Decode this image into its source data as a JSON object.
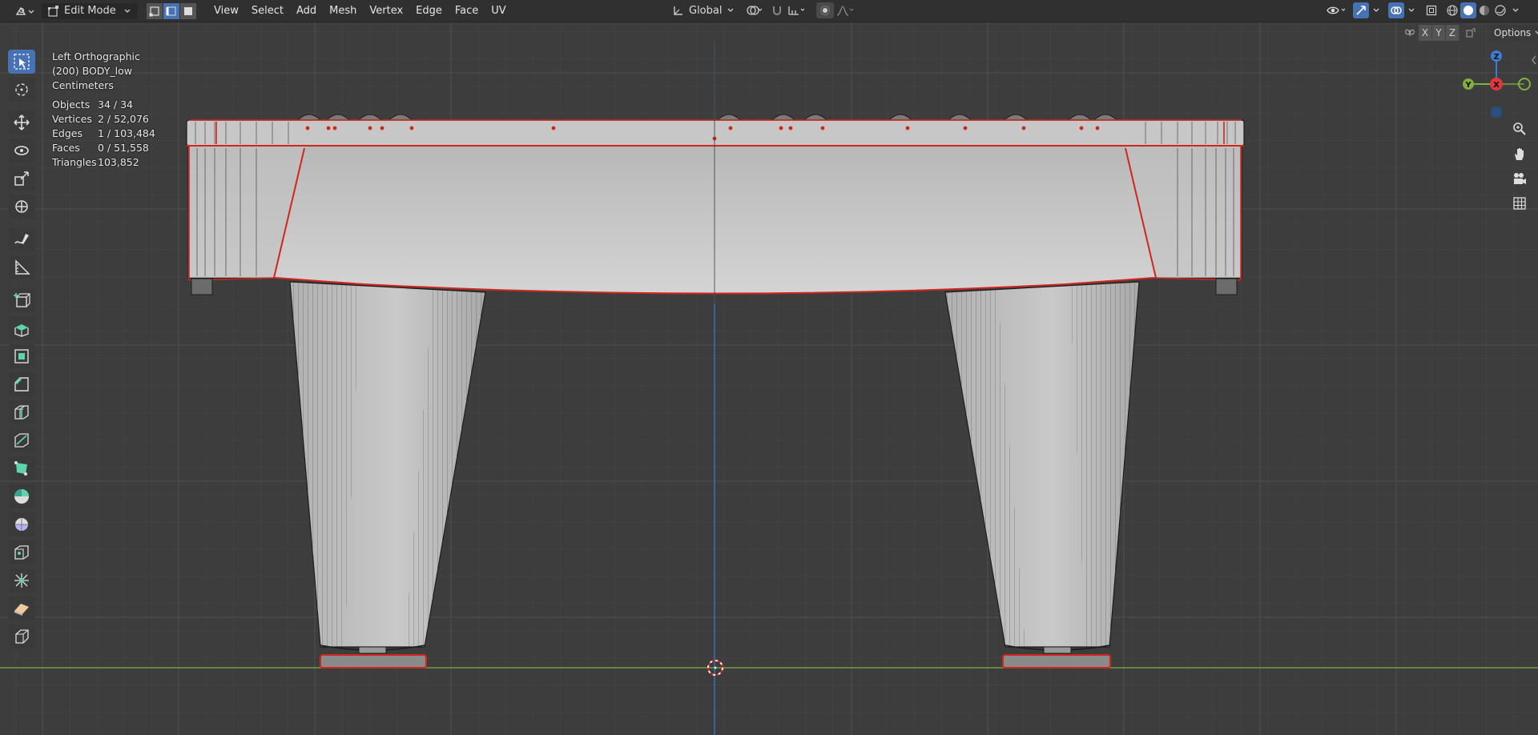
{
  "header": {
    "mode_label": "Edit Mode",
    "menus": [
      "View",
      "Select",
      "Add",
      "Mesh",
      "Vertex",
      "Edge",
      "Face",
      "UV"
    ],
    "transform_orientation": "Global"
  },
  "row2": {
    "axis_x": "X",
    "axis_y": "Y",
    "axis_z": "Z",
    "options_label": "Options"
  },
  "overlay": {
    "view_name": "Left Orthographic",
    "object_name": "(200) BODY_low",
    "units": "Centimeters",
    "stats": [
      {
        "label": "Objects",
        "value": "34 / 34"
      },
      {
        "label": "Vertices",
        "value": "2 / 52,076"
      },
      {
        "label": "Edges",
        "value": "1 / 103,484"
      },
      {
        "label": "Faces",
        "value": "0 / 51,558"
      },
      {
        "label": "Triangles",
        "value": "103,852"
      }
    ]
  },
  "gizmo": {
    "z_label": "Z",
    "y_label": "Y",
    "x_label": "X"
  },
  "colors": {
    "header_bg": "#303030",
    "viewport_bg": "#3d3d3d",
    "active_blue": "#4772b3",
    "selection_red": "#d0261d",
    "axis_green": "#7fb040",
    "axis_blue": "#3b7cd6",
    "axis_red": "#e0373c"
  },
  "tools": [
    "select-box-icon",
    "cursor-icon",
    "move-icon",
    "rotate-icon",
    "scale-icon",
    "transform-icon",
    "annotate-icon",
    "measure-icon",
    "add-cube-icon",
    "extrude-icon",
    "inset-icon",
    "bevel-icon",
    "loop-cut-icon",
    "knife-icon",
    "poly-build-icon",
    "spin-icon",
    "smooth-icon",
    "edge-slide-icon",
    "shrink-fatten-icon",
    "shear-icon",
    "rip-region-icon"
  ]
}
